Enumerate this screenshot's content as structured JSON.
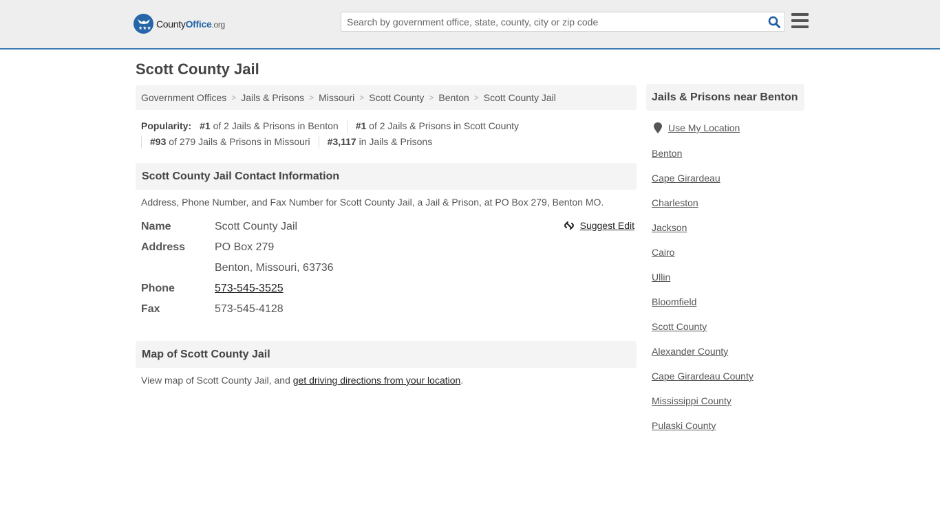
{
  "header": {
    "logo": {
      "part1": "County",
      "part2": "Office",
      "part3": ".org"
    },
    "search_placeholder": "Search by government office, state, county, city or zip code",
    "search_icon": "search-icon",
    "menu_icon": "hamburger-menu-icon"
  },
  "page": {
    "title": "Scott County Jail",
    "breadcrumb": [
      "Government Offices",
      "Jails & Prisons",
      "Missouri",
      "Scott County",
      "Benton",
      "Scott County Jail"
    ],
    "popularity": {
      "label": "Popularity:",
      "items": [
        {
          "rank": "#1",
          "text": " of 2 Jails & Prisons in Benton"
        },
        {
          "rank": "#1",
          "text": " of 2 Jails & Prisons in Scott County"
        },
        {
          "rank": "#93",
          "text": " of 279 Jails & Prisons in Missouri"
        },
        {
          "rank": "#3,117",
          "text": " in Jails & Prisons"
        }
      ]
    }
  },
  "contact": {
    "heading": "Scott County Jail Contact Information",
    "description": "Address, Phone Number, and Fax Number for Scott County Jail, a Jail & Prison, at PO Box 279, Benton MO.",
    "suggest_edit": "Suggest Edit",
    "rows": {
      "name_label": "Name",
      "name_value": "Scott County Jail",
      "address_label": "Address",
      "address_line1": "PO Box 279",
      "address_line2": "Benton, Missouri, 63736",
      "phone_label": "Phone",
      "phone_value": "573-545-3525",
      "fax_label": "Fax",
      "fax_value": "573-545-4128"
    }
  },
  "map": {
    "heading": "Map of Scott County Jail",
    "text_prefix": "View map of Scott County Jail, and ",
    "link": "get driving directions from your location",
    "text_suffix": "."
  },
  "sidebar": {
    "heading": "Jails & Prisons near Benton",
    "use_location": "Use My Location",
    "links": [
      "Benton",
      "Cape Girardeau",
      "Charleston",
      "Jackson",
      "Cairo",
      "Ullin",
      "Bloomfield",
      "Scott County",
      "Alexander County",
      "Cape Girardeau County",
      "Mississippi County",
      "Pulaski County"
    ]
  }
}
